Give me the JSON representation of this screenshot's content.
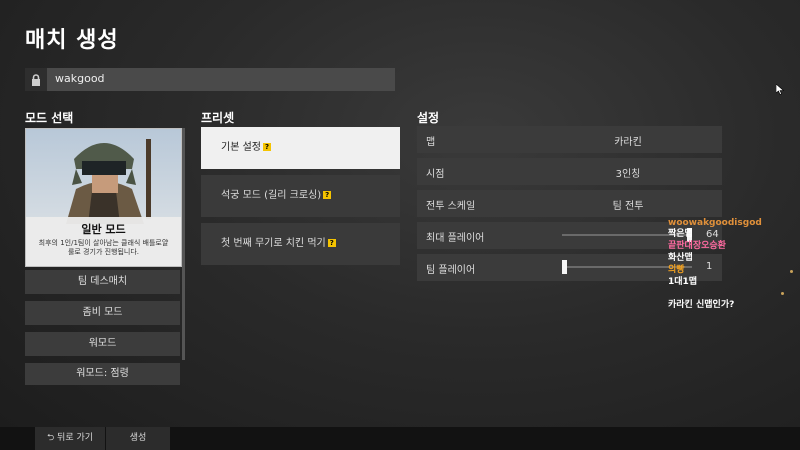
{
  "page_title": "매치 생성",
  "name_field": {
    "value": "wakgood"
  },
  "mode_select": {
    "heading": "모드 선택",
    "featured": {
      "title": "일반 모드",
      "desc_line1": "최후의 1인/1팀이 살아남는 클래식 배틀로얄",
      "desc_line2": "룰로 경기가 진행됩니다."
    },
    "buttons": [
      "팀 데스매치",
      "좀비 모드",
      "워모드",
      "워모드: 점령"
    ]
  },
  "presets": {
    "heading": "프리셋",
    "items": [
      "기본 설정",
      "석궁 모드 (길리 크로싱)",
      "첫 번째 무기로 치킨 먹기"
    ]
  },
  "settings": {
    "heading": "설정",
    "map": {
      "label": "맵",
      "value": "카라킨"
    },
    "view": {
      "label": "시점",
      "value": "3인칭"
    },
    "scale": {
      "label": "전투 스케일",
      "value": "팀 전투"
    },
    "max_players": {
      "label": "최대 플레이어",
      "value": "64",
      "fraction": 1.0
    },
    "team_players": {
      "label": "팀 플레이어",
      "value": "1",
      "fraction": 0.0
    }
  },
  "chat": [
    {
      "text": "woowakgoodisgod",
      "color": "#e0903a"
    },
    {
      "text": "짝은맵",
      "color": "#ffffff"
    },
    {
      "text": "끝판대장오승환",
      "color": "#ff6aa0"
    },
    {
      "text": "화산맵",
      "color": "#ffffff"
    },
    {
      "text": "의빵",
      "color": "#f0a020"
    },
    {
      "text": "1대1맵",
      "color": "#ffffff"
    },
    {
      "text": "카라킨 신맵인가?",
      "color": "#ffffff"
    }
  ],
  "footer": {
    "back_label": "뒤로 가기",
    "create_label": "생성"
  },
  "icons": {
    "lock": "lock-icon",
    "back": "back-arrow-icon",
    "help": "question-icon",
    "cursor": "mouse-cursor-icon"
  },
  "colors": {
    "help_badge": "#f5c400",
    "selected_preset": "#f0f0f0"
  }
}
